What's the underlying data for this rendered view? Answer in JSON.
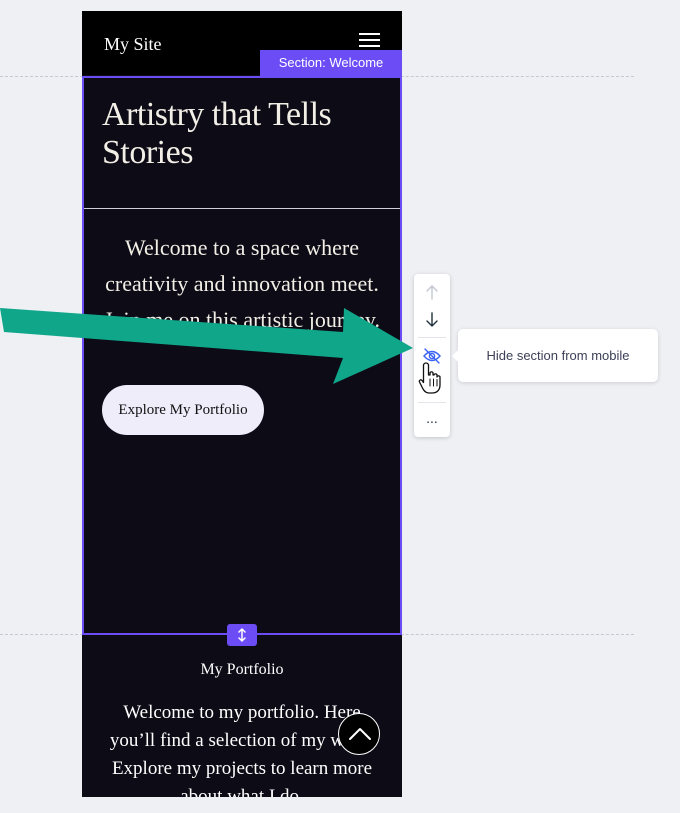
{
  "site": {
    "name": "My Site"
  },
  "section": {
    "tag": "Section: Welcome"
  },
  "hero": {
    "title": "Artistry that Tells Stories",
    "text": "Welcome to a space where creativity and innovation meet. Join me on this artistic journey.",
    "cta_label": "Explore My Portfolio"
  },
  "portfolio": {
    "title": "My Portfolio",
    "text": "Welcome to my portfolio. Here you’ll find a selection of my work. Explore my projects to learn more about what I do."
  },
  "toolbar": {
    "more_label": "...",
    "tooltip": "Hide section from mobile"
  },
  "icons": {
    "move_up": "arrow-up-icon",
    "move_down": "arrow-down-icon",
    "hide": "eye-off-icon",
    "more": "more-icon",
    "resize": "resize-vertical-icon",
    "scroll_top": "chevron-up-icon",
    "menu": "hamburger-icon"
  },
  "colors": {
    "accent": "#6b4cf5",
    "arrow": "#0fa68a",
    "page_bg": "#0d0b16",
    "canvas_bg": "#eef0f4"
  }
}
